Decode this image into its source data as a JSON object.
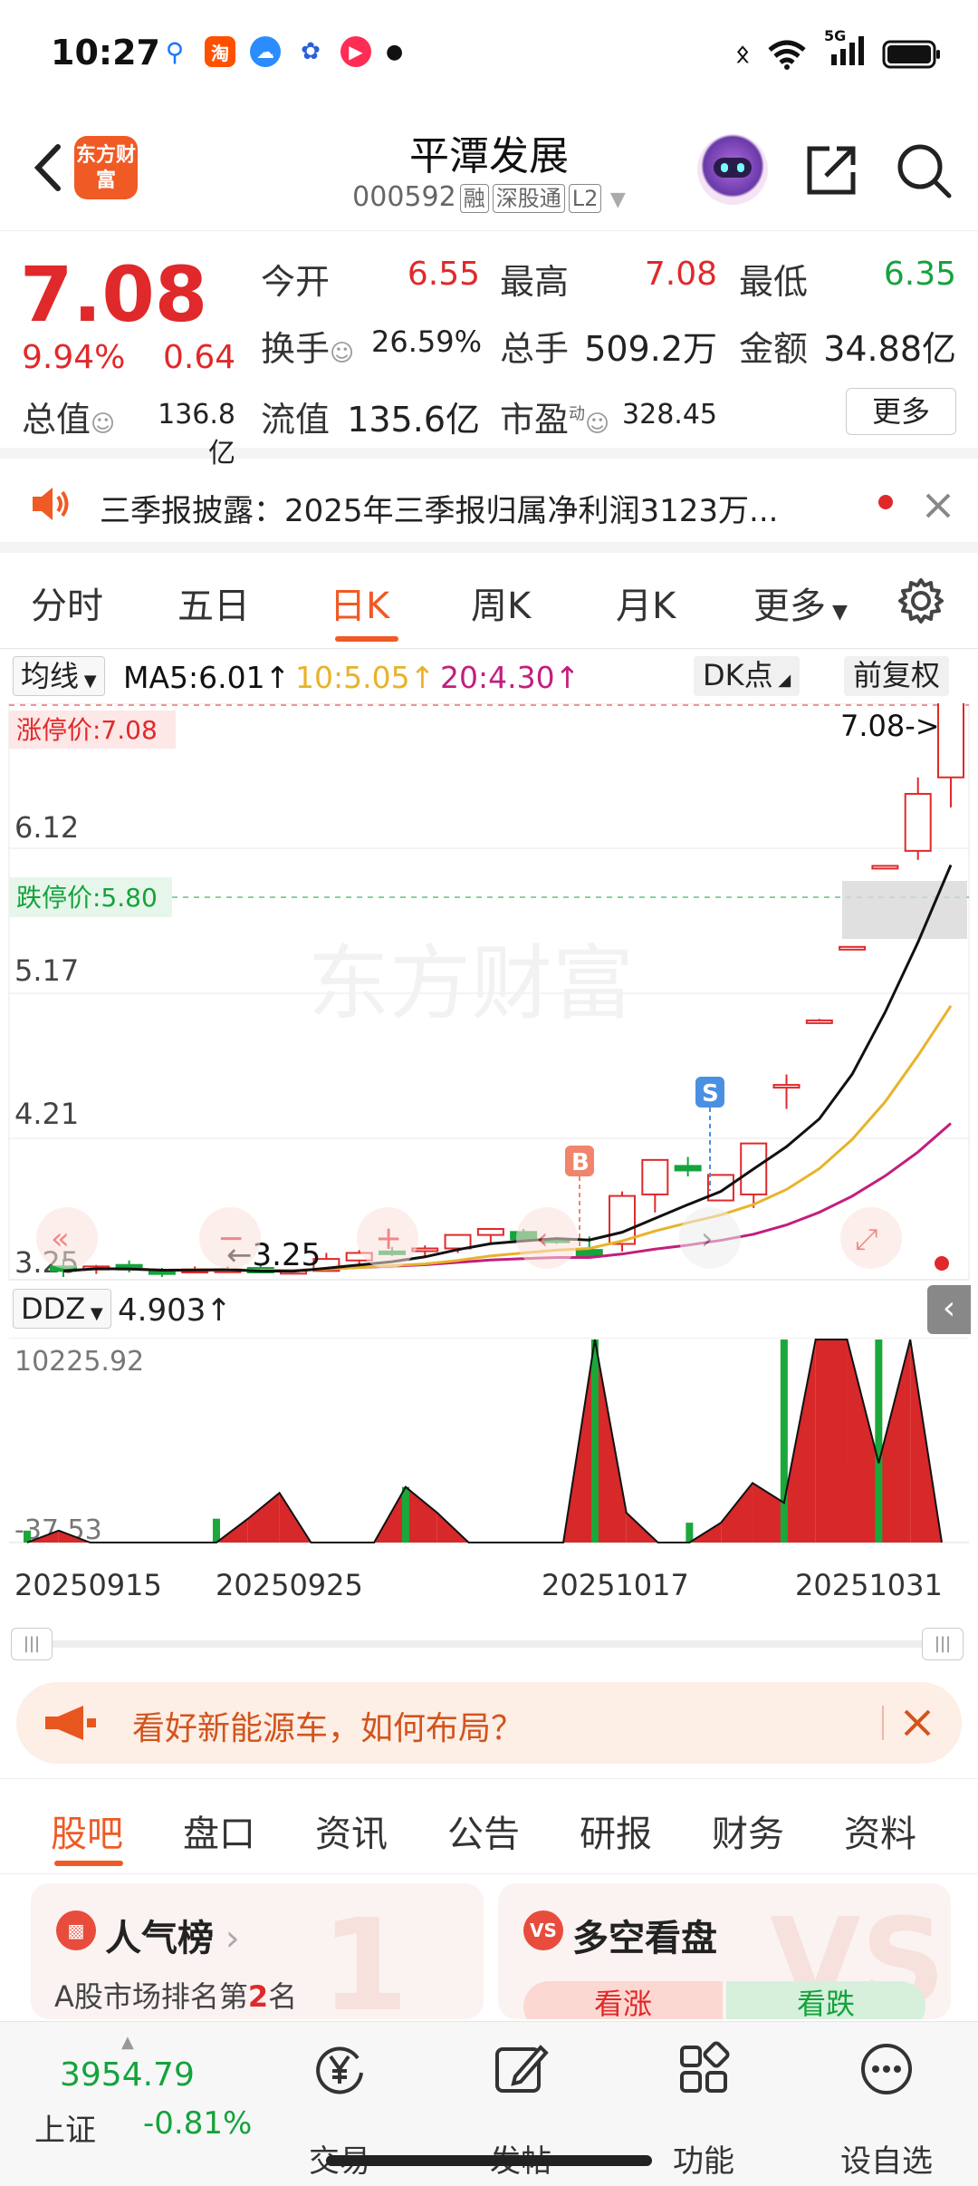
{
  "status_bar": {
    "time": "10:27",
    "app_icons": [
      "alipay-search-icon",
      "taobao-icon",
      "cloud-icon",
      "baidu-icon",
      "music-icon"
    ],
    "network": "5G"
  },
  "header": {
    "brand_logo_text": "东方财富",
    "stock_name": "平潭发展",
    "stock_code": "000592",
    "tags": [
      "融",
      "深股通",
      "L2"
    ]
  },
  "quote": {
    "price": "7.08",
    "change_pct": "9.94%",
    "change_abs": "0.64",
    "rows": [
      [
        {
          "label": "今开",
          "value": "6.55",
          "color": "red"
        },
        {
          "label": "最高",
          "value": "7.08",
          "color": "red"
        },
        {
          "label": "最低",
          "value": "6.35",
          "color": "green"
        }
      ],
      [
        {
          "label": "换手",
          "value": "26.59%",
          "color": "dark"
        },
        {
          "label": "总手",
          "value": "509.2万",
          "color": "dark"
        },
        {
          "label": "金额",
          "value": "34.88亿",
          "color": "dark"
        }
      ]
    ],
    "total_cap_label": "总值",
    "total_cap_value": "136.8亿",
    "float_cap_label": "流值",
    "float_cap_value": "135.6亿",
    "pe_label": "市盈",
    "pe_superscript": "动",
    "pe_value": "328.45",
    "more_label": "更多"
  },
  "notice": {
    "text": "三季报披露：2025年三季报归属净利润3123万..."
  },
  "period_tabs": [
    "分时",
    "五日",
    "日K",
    "周K",
    "月K",
    "更多"
  ],
  "active_period": "日K",
  "ma_row": {
    "select_label": "均线",
    "ma5": "MA5:6.01↑",
    "ma10": "10:5.05↑",
    "ma20": "20:4.30↑",
    "dk_label": "DK点",
    "fq_label": "前复权"
  },
  "kchart_labels": {
    "limit_up": "涨停价:7.08",
    "limit_down": "跌停价:5.80",
    "y_ticks": [
      "6.12",
      "5.17",
      "4.21",
      "3.25"
    ],
    "last_price_tag": "7.08->",
    "low_tag": "3.25",
    "marker_b": "B",
    "marker_s": "S",
    "watermark": "东方财富"
  },
  "ddz": {
    "select_label": "DDZ",
    "value": "4.903↑",
    "y_max": "10225.92",
    "y_min": "-37.53"
  },
  "dates": [
    "20250915",
    "20250925",
    "20251017",
    "20251031"
  ],
  "colors": {
    "accent": "#f05a24",
    "up": "#e0292a",
    "down": "#14a33c",
    "ma5": "#111111",
    "ma10": "#e8b32a",
    "ma20": "#c21e7e"
  },
  "chart_data": [
    {
      "type": "candlestick",
      "x": [
        "20250915",
        "20250925",
        "20251017",
        "20251031"
      ],
      "ohlc": [
        [
          3.29,
          3.34,
          3.22,
          3.26
        ],
        [
          3.27,
          3.3,
          3.24,
          3.29
        ],
        [
          3.3,
          3.33,
          3.25,
          3.27
        ],
        [
          3.26,
          3.28,
          3.22,
          3.24
        ],
        [
          3.25,
          3.29,
          3.25,
          3.27
        ],
        [
          3.26,
          3.29,
          3.25,
          3.27
        ],
        [
          3.28,
          3.3,
          3.25,
          3.25
        ],
        [
          3.25,
          3.27,
          3.25,
          3.26
        ],
        [
          3.26,
          3.38,
          3.26,
          3.34
        ],
        [
          3.33,
          3.4,
          3.29,
          3.38
        ],
        [
          3.39,
          3.42,
          3.36,
          3.38
        ],
        [
          3.41,
          3.43,
          3.36,
          3.41
        ],
        [
          3.41,
          3.44,
          3.38,
          3.5
        ],
        [
          3.5,
          3.54,
          3.44,
          3.54
        ],
        [
          3.52,
          3.54,
          3.48,
          3.47
        ],
        [
          3.47,
          3.48,
          3.44,
          3.46
        ],
        [
          3.4,
          3.49,
          3.35,
          3.36
        ],
        [
          3.44,
          3.79,
          3.39,
          3.76
        ],
        [
          3.77,
          3.99,
          3.65,
          4.0
        ],
        [
          3.96,
          4.02,
          3.89,
          3.93
        ],
        [
          3.73,
          3.86,
          3.73,
          3.9
        ],
        [
          3.77,
          4.0,
          3.68,
          4.11
        ],
        [
          4.5,
          4.57,
          4.34,
          4.5
        ],
        [
          4.93,
          4.94,
          4.93,
          4.93
        ],
        [
          5.42,
          5.42,
          5.42,
          5.42
        ],
        [
          5.96,
          5.96,
          5.96,
          5.96
        ],
        [
          6.06,
          6.55,
          6.0,
          6.44
        ],
        [
          6.55,
          7.08,
          6.35,
          7.08
        ]
      ],
      "ma5": 6.01,
      "ma10": 5.05,
      "ma20": 4.3,
      "limit_up": 7.08,
      "limit_down": 5.8,
      "ylim": [
        3.25,
        7.08
      ]
    },
    {
      "type": "area",
      "name": "DDZ",
      "x": [
        "20250915",
        "20250925",
        "20251017",
        "20251031"
      ],
      "values": [
        0,
        600,
        0,
        0,
        0,
        0,
        0,
        1200,
        2500,
        0,
        0,
        0,
        2800,
        1500,
        0,
        0,
        0,
        0,
        10225.92,
        1500,
        0,
        0,
        1000,
        3000,
        2000,
        10225.92,
        10225.92,
        4000,
        10225.92,
        4.903
      ],
      "ylim": [
        -37.53,
        10225.92
      ]
    }
  ],
  "promo": {
    "text": "看好新能源车，如何布局？"
  },
  "sub_tabs": [
    "股吧",
    "盘口",
    "资讯",
    "公告",
    "研报",
    "财务",
    "资料"
  ],
  "active_sub_tab": "股吧",
  "cards": {
    "popularity": {
      "title": "人气榜",
      "subtitle_prefix": "A股市场排名第",
      "rank": "2",
      "subtitle_suffix": "名"
    },
    "bull_bear": {
      "title": "多空看盘",
      "bull": "看涨",
      "bear": "看跌"
    }
  },
  "bottom_nav": {
    "index_value": "3954.79",
    "index_name": "上证",
    "index_change": "-0.81%",
    "items": [
      "交易",
      "发帖",
      "功能",
      "设自选"
    ]
  }
}
